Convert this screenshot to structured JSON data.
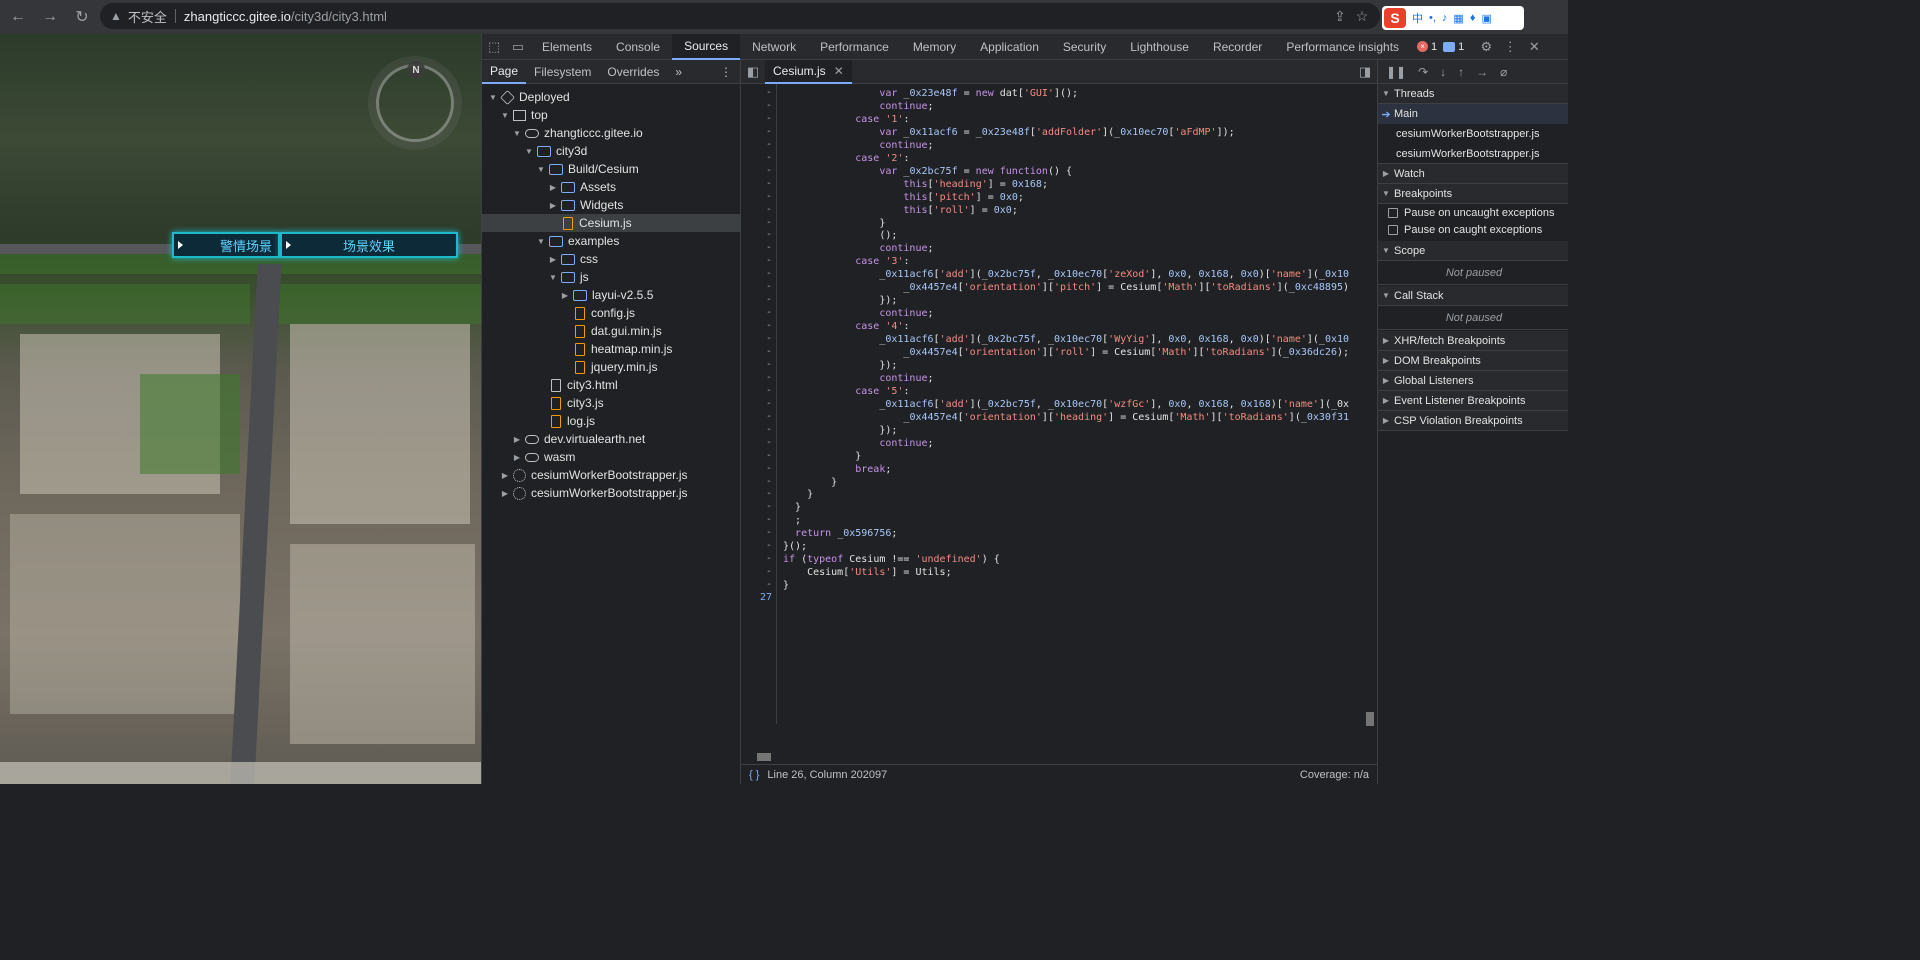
{
  "browser": {
    "insecure_label": "不安全",
    "url_host": "zhangticcc.gitee.io",
    "url_path": "/city3d/city3.html"
  },
  "scene": {
    "buttons": [
      "警情场景",
      "场景效果"
    ],
    "compass_label": "N"
  },
  "devtools": {
    "tabs": [
      "Elements",
      "Console",
      "Sources",
      "Network",
      "Performance",
      "Memory",
      "Application",
      "Security",
      "Lighthouse",
      "Recorder",
      "Performance insights"
    ],
    "active_tab": "Sources",
    "error_count": "1",
    "message_count": "1",
    "navigator_tabs": [
      "Page",
      "Filesystem",
      "Overrides"
    ],
    "tree": [
      {
        "label": "Deployed",
        "indent": 0,
        "arrow": "▼",
        "icon": "box"
      },
      {
        "label": "top",
        "indent": 1,
        "arrow": "▼",
        "icon": "frame"
      },
      {
        "label": "zhangticcc.gitee.io",
        "indent": 2,
        "arrow": "▼",
        "icon": "cloud"
      },
      {
        "label": "city3d",
        "indent": 3,
        "arrow": "▼",
        "icon": "folder"
      },
      {
        "label": "Build/Cesium",
        "indent": 4,
        "arrow": "▼",
        "icon": "folder"
      },
      {
        "label": "Assets",
        "indent": 5,
        "arrow": "▶",
        "icon": "folder"
      },
      {
        "label": "Widgets",
        "indent": 5,
        "arrow": "▶",
        "icon": "folder"
      },
      {
        "label": "Cesium.js",
        "indent": 5,
        "arrow": "",
        "icon": "file",
        "selected": true
      },
      {
        "label": "examples",
        "indent": 4,
        "arrow": "▼",
        "icon": "folder"
      },
      {
        "label": "css",
        "indent": 5,
        "arrow": "▶",
        "icon": "folder"
      },
      {
        "label": "js",
        "indent": 5,
        "arrow": "▼",
        "icon": "folder"
      },
      {
        "label": "layui-v2.5.5",
        "indent": 6,
        "arrow": "▶",
        "icon": "folder"
      },
      {
        "label": "config.js",
        "indent": 6,
        "arrow": "",
        "icon": "file"
      },
      {
        "label": "dat.gui.min.js",
        "indent": 6,
        "arrow": "",
        "icon": "file"
      },
      {
        "label": "heatmap.min.js",
        "indent": 6,
        "arrow": "",
        "icon": "file"
      },
      {
        "label": "jquery.min.js",
        "indent": 6,
        "arrow": "",
        "icon": "file"
      },
      {
        "label": "city3.html",
        "indent": 4,
        "arrow": "",
        "icon": "html"
      },
      {
        "label": "city3.js",
        "indent": 4,
        "arrow": "",
        "icon": "file"
      },
      {
        "label": "log.js",
        "indent": 4,
        "arrow": "",
        "icon": "file"
      },
      {
        "label": "dev.virtualearth.net",
        "indent": 2,
        "arrow": "▶",
        "icon": "cloud"
      },
      {
        "label": "wasm",
        "indent": 2,
        "arrow": "▶",
        "icon": "cloud"
      },
      {
        "label": "cesiumWorkerBootstrapper.js",
        "indent": 1,
        "arrow": "▶",
        "icon": "gear"
      },
      {
        "label": "cesiumWorkerBootstrapper.js",
        "indent": 1,
        "arrow": "▶",
        "icon": "gear"
      }
    ],
    "editor_tab": "Cesium.js",
    "code_lines": [
      {
        "g": "-",
        "t": "                var _0x23e48f = new dat['GUI']();"
      },
      {
        "g": "-",
        "t": "                continue;"
      },
      {
        "g": "-",
        "t": "            case '1':"
      },
      {
        "g": "-",
        "t": "                var _0x11acf6 = _0x23e48f['addFolder'](_0x10ec70['aFdMP']);"
      },
      {
        "g": "-",
        "t": "                continue;"
      },
      {
        "g": "-",
        "t": "            case '2':"
      },
      {
        "g": "-",
        "t": "                var _0x2bc75f = new function() {"
      },
      {
        "g": "-",
        "t": "                    this['heading'] = 0x168;"
      },
      {
        "g": "-",
        "t": "                    this['pitch'] = 0x0;"
      },
      {
        "g": "-",
        "t": "                    this['roll'] = 0x0;"
      },
      {
        "g": "-",
        "t": "                }"
      },
      {
        "g": "-",
        "t": "                ();"
      },
      {
        "g": "-",
        "t": "                continue;"
      },
      {
        "g": "-",
        "t": "            case '3':"
      },
      {
        "g": "-",
        "t": "                _0x11acf6['add'](_0x2bc75f, _0x10ec70['zeXod'], 0x0, 0x168, 0x0)['name'](_0x10"
      },
      {
        "g": "-",
        "t": "                    _0x4457e4['orientation']['pitch'] = Cesium['Math']['toRadians'](_0xc48895)"
      },
      {
        "g": "-",
        "t": "                });"
      },
      {
        "g": "-",
        "t": "                continue;"
      },
      {
        "g": "-",
        "t": "            case '4':"
      },
      {
        "g": "-",
        "t": "                _0x11acf6['add'](_0x2bc75f, _0x10ec70['WyYig'], 0x0, 0x168, 0x0)['name'](_0x10"
      },
      {
        "g": "-",
        "t": "                    _0x4457e4['orientation']['roll'] = Cesium['Math']['toRadians'](_0x36dc26);"
      },
      {
        "g": "-",
        "t": "                });"
      },
      {
        "g": "-",
        "t": "                continue;"
      },
      {
        "g": "-",
        "t": "            case '5':"
      },
      {
        "g": "-",
        "t": "                _0x11acf6['add'](_0x2bc75f, _0x10ec70['wzfGc'], 0x0, 0x168, 0x168)['name'](_0x"
      },
      {
        "g": "-",
        "t": "                    _0x4457e4['orientation']['heading'] = Cesium['Math']['toRadians'](_0x30f31"
      },
      {
        "g": "-",
        "t": "                });"
      },
      {
        "g": "-",
        "t": "                continue;"
      },
      {
        "g": "-",
        "t": "            }"
      },
      {
        "g": "-",
        "t": "            break;"
      },
      {
        "g": "-",
        "t": "        }"
      },
      {
        "g": "-",
        "t": "    }"
      },
      {
        "g": "-",
        "t": "  }"
      },
      {
        "g": "-",
        "t": "  ;"
      },
      {
        "g": "-",
        "t": "  return _0x596756;"
      },
      {
        "g": "-",
        "t": "}();"
      },
      {
        "g": "-",
        "t": "if (typeof Cesium !== 'undefined') {"
      },
      {
        "g": "-",
        "t": "    Cesium['Utils'] = Utils;"
      },
      {
        "g": "-",
        "t": "}"
      },
      {
        "g": "27",
        "t": ""
      }
    ],
    "status": {
      "position": "Line 26, Column 202097",
      "coverage": "Coverage: n/a"
    },
    "debugger": {
      "threads_title": "Threads",
      "threads": [
        "Main",
        "cesiumWorkerBootstrapper.js",
        "cesiumWorkerBootstrapper.js"
      ],
      "watch": "Watch",
      "breakpoints": "Breakpoints",
      "pause_uncaught": "Pause on uncaught exceptions",
      "pause_caught": "Pause on caught exceptions",
      "scope": "Scope",
      "not_paused": "Not paused",
      "call_stack": "Call Stack",
      "panes": [
        "XHR/fetch Breakpoints",
        "DOM Breakpoints",
        "Global Listeners",
        "Event Listener Breakpoints",
        "CSP Violation Breakpoints"
      ]
    }
  }
}
